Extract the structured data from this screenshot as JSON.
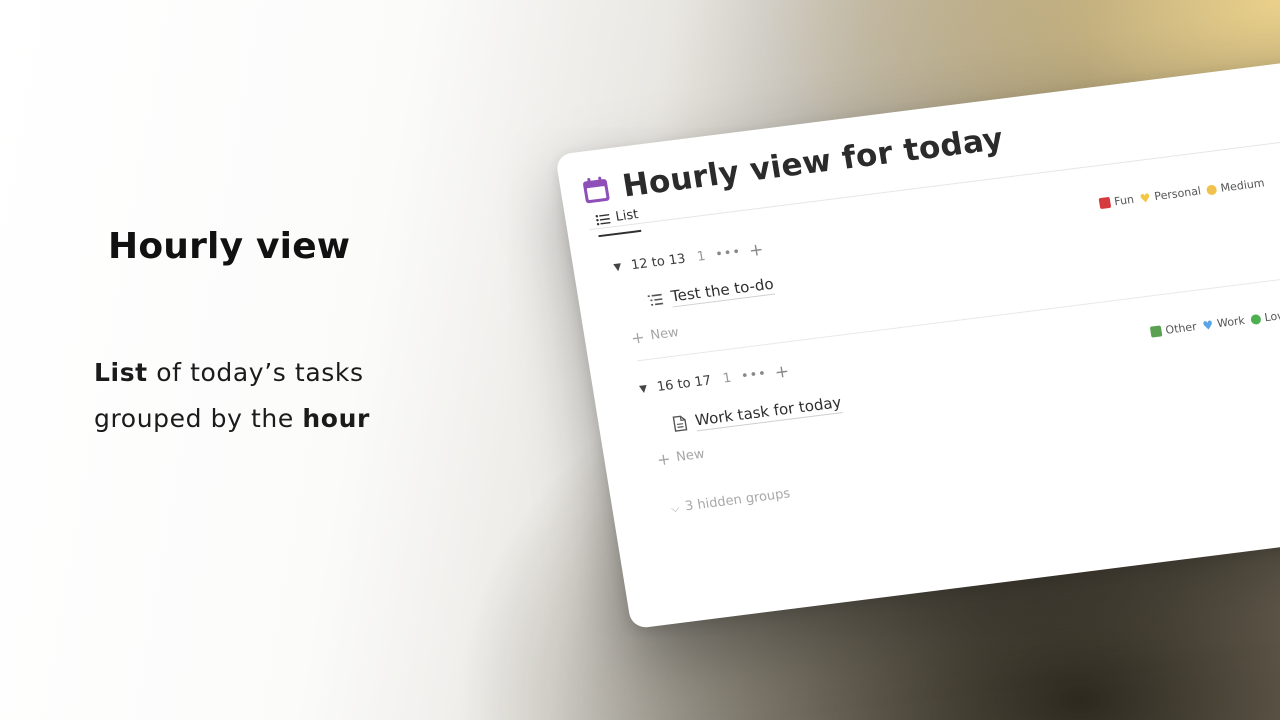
{
  "hero": {
    "title": "Hourly view",
    "desc_bold_1": "List",
    "desc_text_1": " of today’s tasks",
    "desc_text_2": "grouped by the ",
    "desc_bold_2": "hour"
  },
  "page": {
    "title": "Hourly view for today",
    "icon": "calendar-icon",
    "view_tab_label": "List"
  },
  "groups": [
    {
      "label": "12 to 13",
      "count": "1",
      "item": {
        "label": "Test the to-do",
        "icon": "checklist-icon"
      },
      "new_label": "New",
      "legend": [
        {
          "type": "square",
          "color": "#d63a3f",
          "label": "Fun"
        },
        {
          "type": "heart",
          "color": "#f2c744",
          "label": "Personal"
        },
        {
          "type": "dot",
          "color": "#f0c24b",
          "label": "Medium"
        }
      ]
    },
    {
      "label": "16 to 17",
      "count": "1",
      "item": {
        "label": "Work task for today",
        "icon": "document-icon"
      },
      "new_label": "New",
      "legend": [
        {
          "type": "square",
          "color": "#5aa152",
          "label": "Other"
        },
        {
          "type": "heart",
          "color": "#5aa5e8",
          "label": "Work"
        },
        {
          "type": "dot",
          "color": "#4caf50",
          "label": "Low"
        }
      ]
    }
  ],
  "hidden_groups_label": "3 hidden groups",
  "colors": {
    "calendar_icon": "#8e4fb8"
  }
}
